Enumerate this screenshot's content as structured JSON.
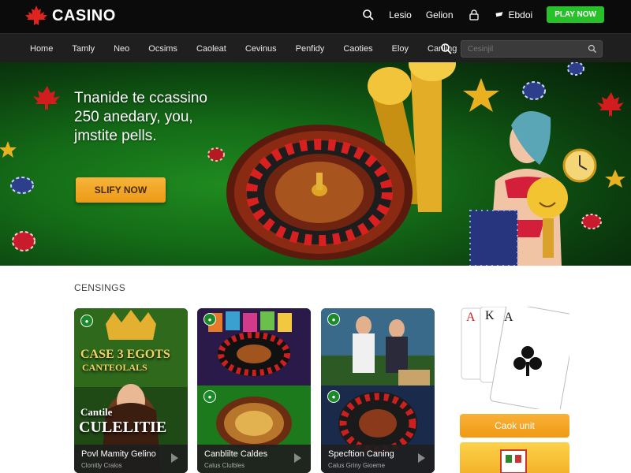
{
  "header": {
    "brand": "CASINO",
    "links": [
      "Lesio",
      "Gelion"
    ],
    "balance_label": "Ebdoi",
    "play_button": "PLAY NOW"
  },
  "nav": {
    "items": [
      "Home",
      "Tamly",
      "Neo",
      "Ocsims",
      "Caoleat",
      "Cevinus",
      "Penfidy",
      "Caoties",
      "Eloy",
      "Canling"
    ],
    "search_placeholder": "Cesinjil"
  },
  "hero": {
    "headline_line1": "Tnanide te ccassino",
    "headline_line2": "250 anedary, you,",
    "headline_line3": "jmstite pells.",
    "cta": "SLIFY NOW"
  },
  "section": {
    "title": "CENSINGS"
  },
  "cards": [
    {
      "title": "Povl Mamity Gelino",
      "sub": "Clonitly Cralos",
      "art_text_top": "CASE 3 EGOTS",
      "art_text_mid": "CANTEOLALS",
      "art_text_small": "Cantile",
      "art_text_big": "CULELITIE"
    },
    {
      "title": "Canblilte Caldes",
      "sub": "Calus Clulbles"
    },
    {
      "title": "Specftion Caning",
      "sub": "Calus Griny Gioeme"
    }
  ],
  "side": {
    "button": "Caok unit"
  },
  "colors": {
    "accent_green": "#27c22a",
    "accent_orange": "#ec9a16",
    "hero_green": "#146b17",
    "topbar": "#0b0b0b",
    "navbar": "#1f1f1f"
  },
  "icons": [
    "maple-leaf-icon",
    "search-icon",
    "lock-icon",
    "wallet-icon",
    "play-icon"
  ]
}
